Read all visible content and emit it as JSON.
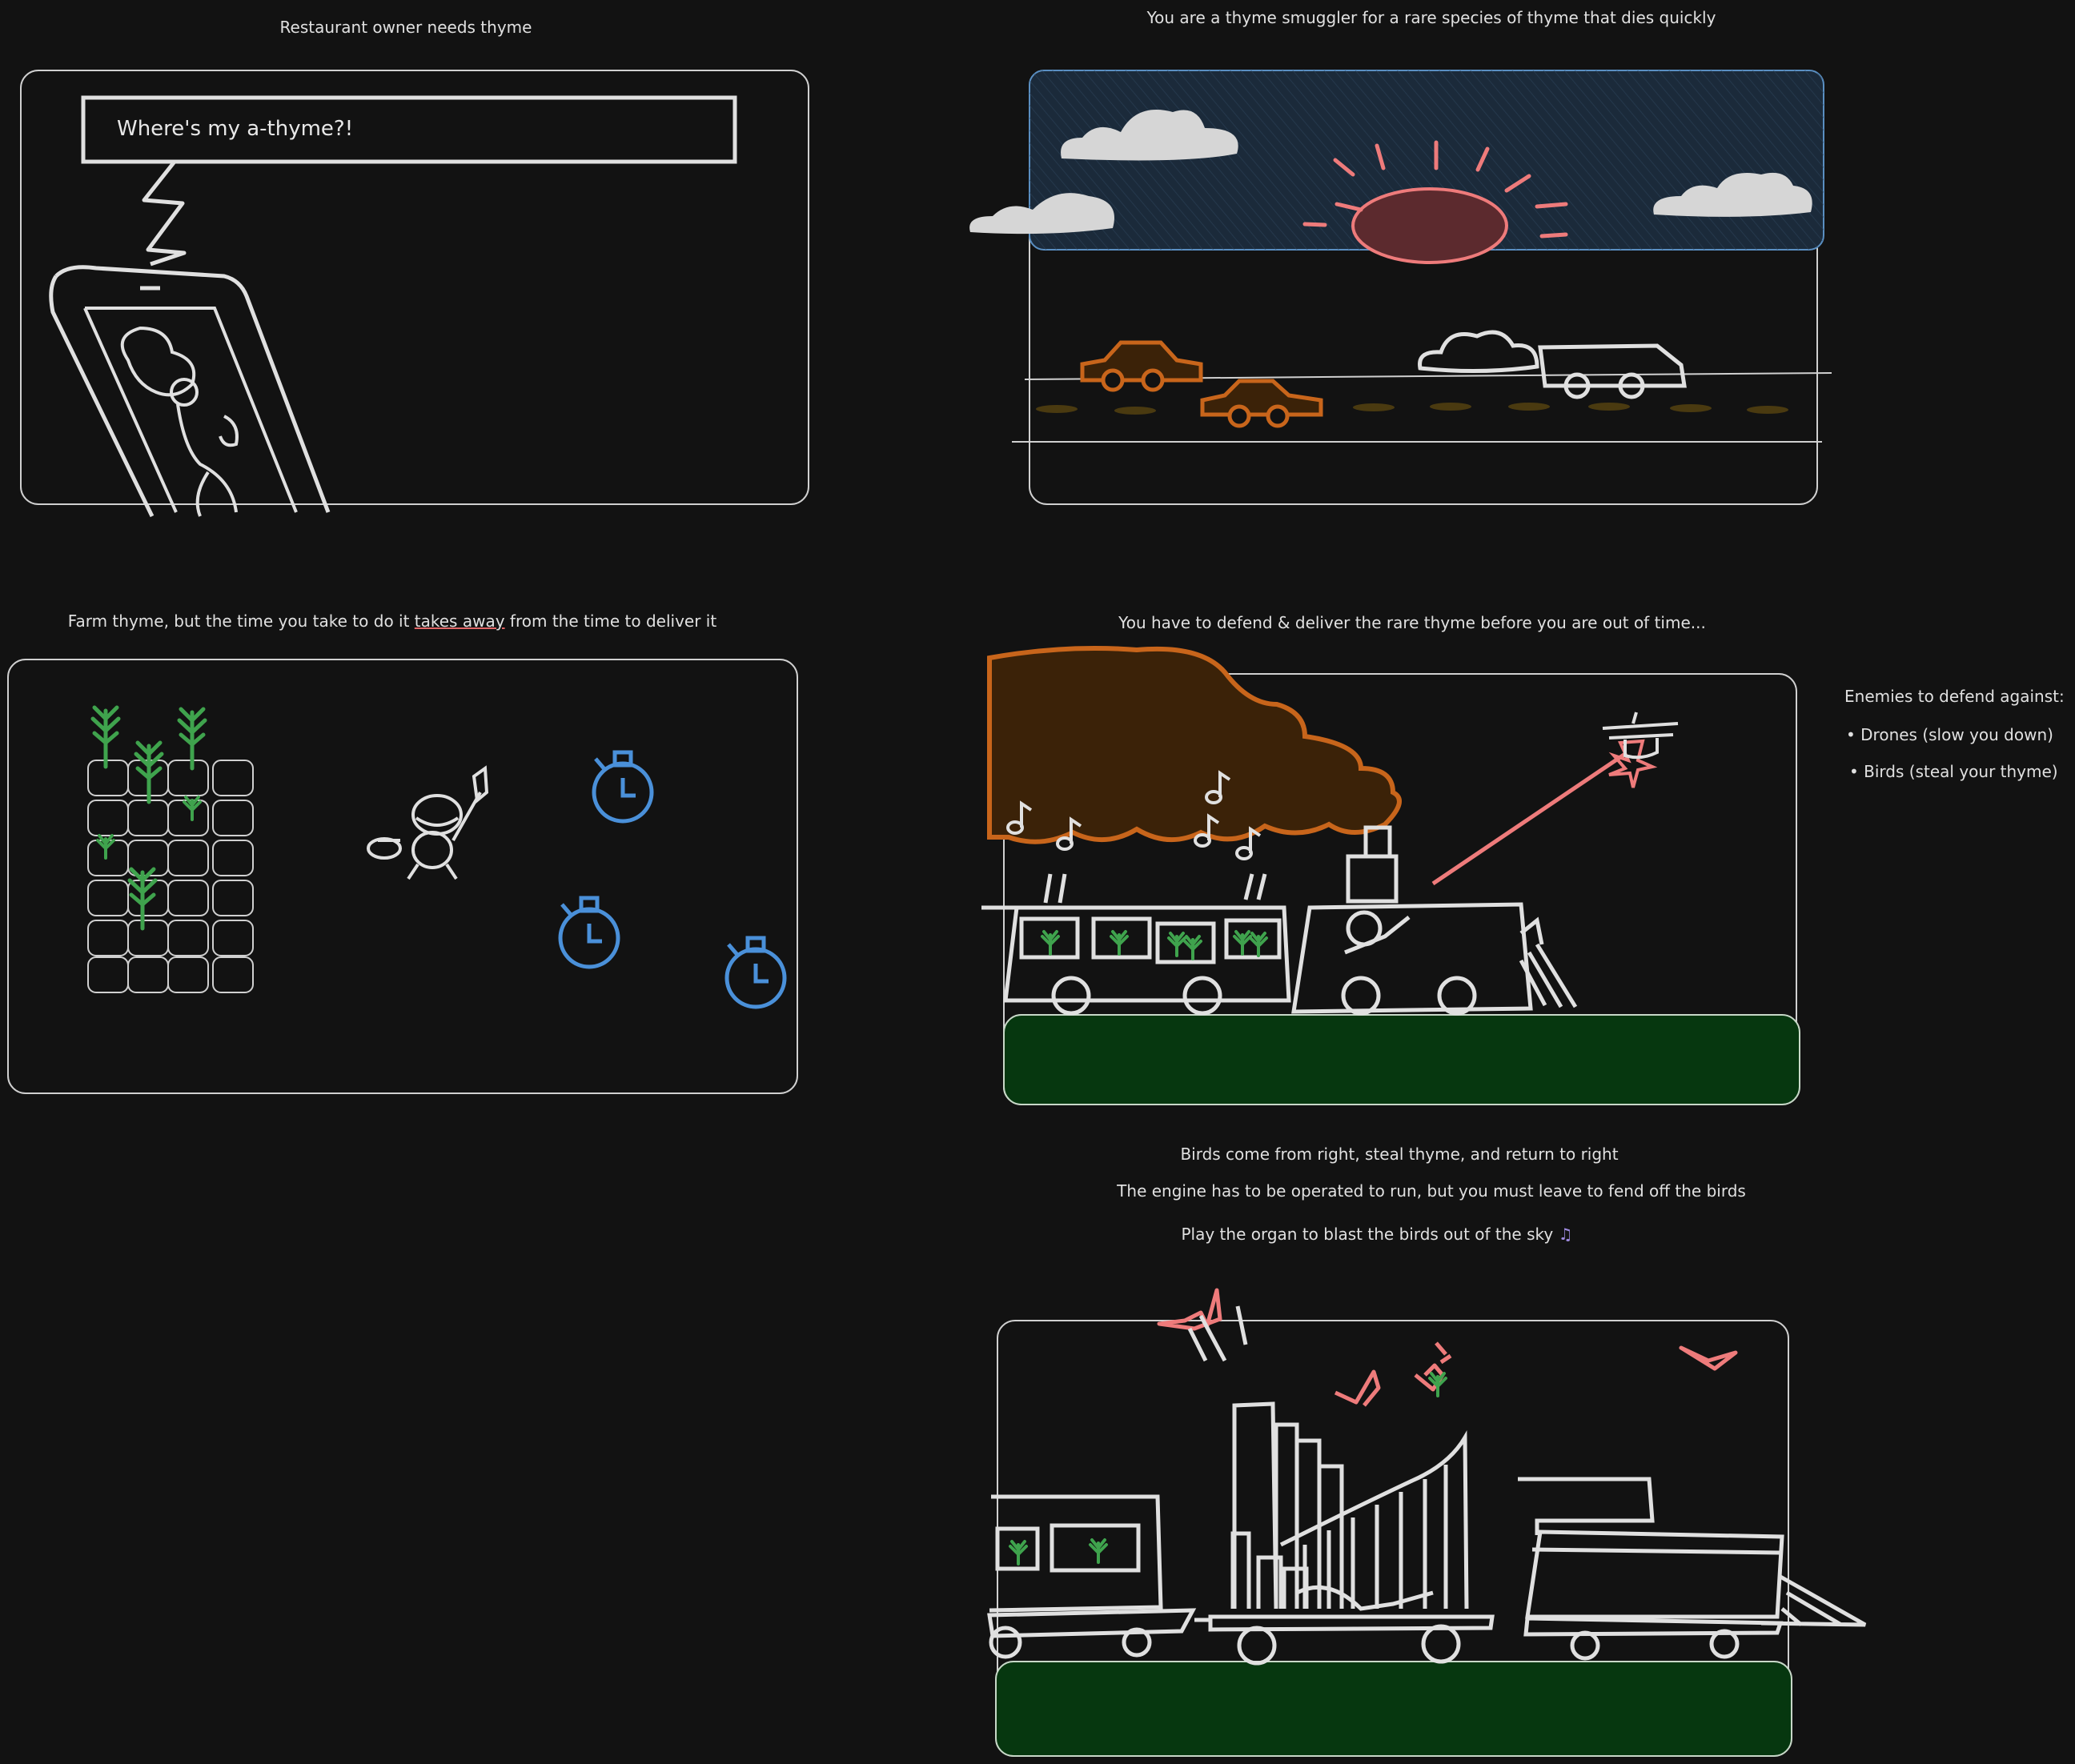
{
  "captions": {
    "panel1": "Restaurant owner needs thyme",
    "panel2": "You are a thyme smuggler for a rare species of thyme that dies quickly",
    "panel3_prefix": "Farm thyme, but the time you take to do it ",
    "panel3_underlined": "takes away",
    "panel3_suffix": " from the time to deliver it",
    "panel4": "You have to defend & deliver the rare thyme before you are out of time...",
    "panel5_line1": "Birds come from right, steal thyme, and return to right",
    "panel5_line2": "The engine has to be operated to run, but you must leave to fend off the birds",
    "panel5_line3": "Play the organ to blast the birds out of the sky"
  },
  "speech_bubble": "Where's my a-thyme?!",
  "enemies": {
    "heading": "Enemies to defend against:",
    "items": [
      "Drones (slow you down)",
      "Birds (steal your thyme)"
    ]
  },
  "colors": {
    "background": "#121212",
    "stroke": "#e0e0e0",
    "plant": "#3fa34d",
    "timer": "#4a90d9",
    "car": "#c8651b",
    "bird": "#ee7b7b",
    "ground": "#06370f",
    "sky": "#1b2a3a",
    "sun": "#5c2a2e",
    "smoke": "#3b2208"
  }
}
